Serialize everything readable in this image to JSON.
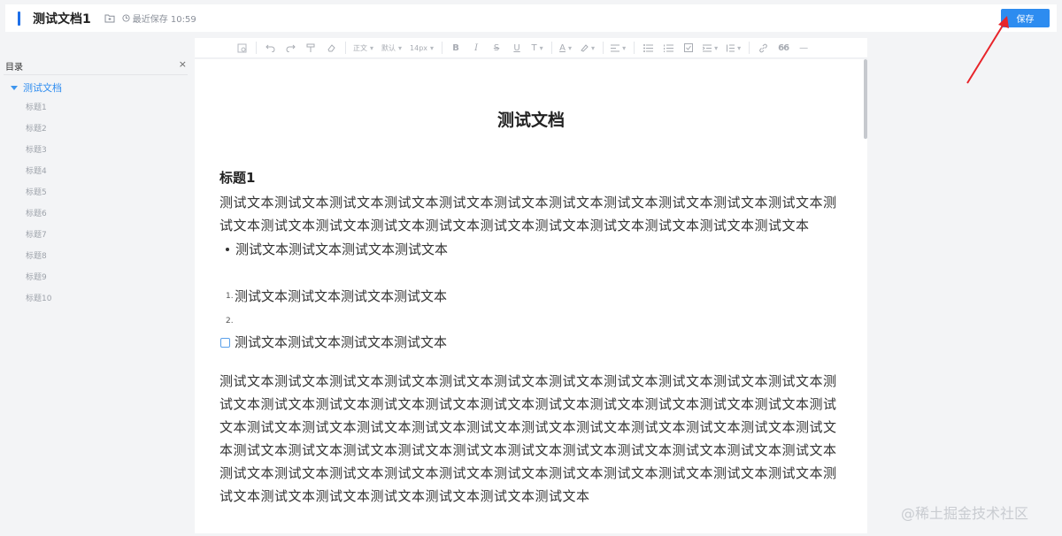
{
  "header": {
    "doc_title": "测试文档1",
    "save_status": "最近保存 10:59",
    "save_label": "保存"
  },
  "sidebar": {
    "title": "目录",
    "close": "×",
    "root": "测试文档",
    "items": [
      "标题1",
      "标题2",
      "标题3",
      "标题4",
      "标题5",
      "标题6",
      "标题7",
      "标题8",
      "标题9",
      "标题10"
    ]
  },
  "toolbar": {
    "paragraph": "正文",
    "font": "默认",
    "size": "14px",
    "bold": "B",
    "italic": "I",
    "strike": "S",
    "underline": "U",
    "sub": "T",
    "font_color": "A",
    "quote": "66",
    "hr": "—"
  },
  "document": {
    "title": "测试文档",
    "heading1": "标题1",
    "para1": "测试文本测试文本测试文本测试文本测试文本测试文本测试文本测试文本测试文本测试文本测试文本测试文本测试文本测试文本测试文本测试文本测试文本测试文本测试文本测试文本测试文本测试文本",
    "bullet": "测试文本测试文本测试文本测试文本",
    "ordered": [
      "测试文本测试文本测试文本测试文本",
      ""
    ],
    "ordered_nums": [
      "1.",
      "2."
    ],
    "todo": "测试文本测试文本测试文本测试文本",
    "para2": "测试文本测试文本测试文本测试文本测试文本测试文本测试文本测试文本测试文本测试文本测试文本测试文本测试文本测试文本测试文本测试文本测试文本测试文本测试文本测试文本测试文本测试文本测试文本测试文本测试文本测试文本测试文本测试文本测试文本测试文本测试文本测试文本测试文本测试文本测试文本测试文本测试文本测试文本测试文本测试文本测试文本测试文本测试文本测试文本测试文本测试文本测试文本测试文本测试文本测试文本测试文本测试文本测试文本测试文本测试文本测试文本测试文本测试文本测试文本测试文本测试文本测试文本测试文本"
  },
  "watermark": "@稀土掘金技术社区",
  "colors": {
    "accent": "#2d8cf0",
    "arrow": "#e8242a",
    "sidebar_item": "#9ea3ab"
  }
}
